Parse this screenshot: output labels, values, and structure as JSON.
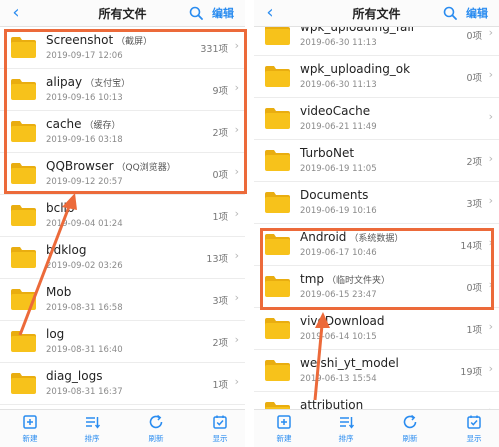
{
  "accent_color": "#2a8cf0",
  "annotation_color": "#ec6a3a",
  "folder_color": "#f7c21b",
  "left_panel": {
    "header": {
      "back_icon": "chevron-left-icon",
      "title": "所有文件",
      "search_icon": "search-icon",
      "edit_label": "编辑"
    },
    "files": [
      {
        "name": "Screenshot",
        "note": "（截屏）",
        "date": "2019-09-17 12:06",
        "count": "331项"
      },
      {
        "name": "alipay",
        "note": "（支付宝）",
        "date": "2019-09-16 10:13",
        "count": "9项"
      },
      {
        "name": "cache",
        "note": "（缓存）",
        "date": "2019-09-16 03:18",
        "count": "2项"
      },
      {
        "name": "QQBrowser",
        "note": "（QQ浏览器）",
        "date": "2019-09-12 20:57",
        "count": "0项"
      },
      {
        "name": "bclib",
        "note": "",
        "date": "2019-09-04 01:24",
        "count": "1项"
      },
      {
        "name": "bdklog",
        "note": "",
        "date": "2019-09-02 03:26",
        "count": "13项"
      },
      {
        "name": "Mob",
        "note": "",
        "date": "2019-08-31 16:58",
        "count": "3项"
      },
      {
        "name": "log",
        "note": "",
        "date": "2019-08-31 16:40",
        "count": "2项"
      },
      {
        "name": "diag_logs",
        "note": "",
        "date": "2019-08-31 16:37",
        "count": "1项"
      }
    ],
    "toolbar": [
      {
        "label": "新建",
        "icon": "new-folder-icon"
      },
      {
        "label": "排序",
        "icon": "sort-icon"
      },
      {
        "label": "刷新",
        "icon": "refresh-icon"
      },
      {
        "label": "显示",
        "icon": "display-icon"
      }
    ]
  },
  "right_panel": {
    "header": {
      "back_icon": "chevron-left-icon",
      "title": "所有文件",
      "search_icon": "search-icon",
      "edit_label": "编辑"
    },
    "files": [
      {
        "name": "wpk_uploading_fail",
        "note": "",
        "date": "2019-06-30 11:13",
        "count": "0项"
      },
      {
        "name": "wpk_uploading_ok",
        "note": "",
        "date": "2019-06-30 11:13",
        "count": "0项"
      },
      {
        "name": "videoCache",
        "note": "",
        "date": "2019-06-21 11:49",
        "count": ""
      },
      {
        "name": "TurboNet",
        "note": "",
        "date": "2019-06-19 11:05",
        "count": "2项"
      },
      {
        "name": "Documents",
        "note": "",
        "date": "2019-06-19 10:16",
        "count": "3项"
      },
      {
        "name": "Android",
        "note": "（系统数据）",
        "date": "2019-06-17 10:46",
        "count": "14项"
      },
      {
        "name": "tmp",
        "note": "（临时文件夹）",
        "date": "2019-06-15 23:47",
        "count": "0项"
      },
      {
        "name": "vivoDownload",
        "note": "",
        "date": "2019-06-14 10:15",
        "count": "1项"
      },
      {
        "name": "weishi_yt_model",
        "note": "",
        "date": "2019-06-13 15:54",
        "count": "19项"
      },
      {
        "name": "attribution",
        "note": "",
        "date": "",
        "count": ""
      }
    ],
    "toolbar": [
      {
        "label": "新建",
        "icon": "new-folder-icon"
      },
      {
        "label": "排序",
        "icon": "sort-icon"
      },
      {
        "label": "刷新",
        "icon": "refresh-icon"
      },
      {
        "label": "显示",
        "icon": "display-icon"
      }
    ]
  }
}
